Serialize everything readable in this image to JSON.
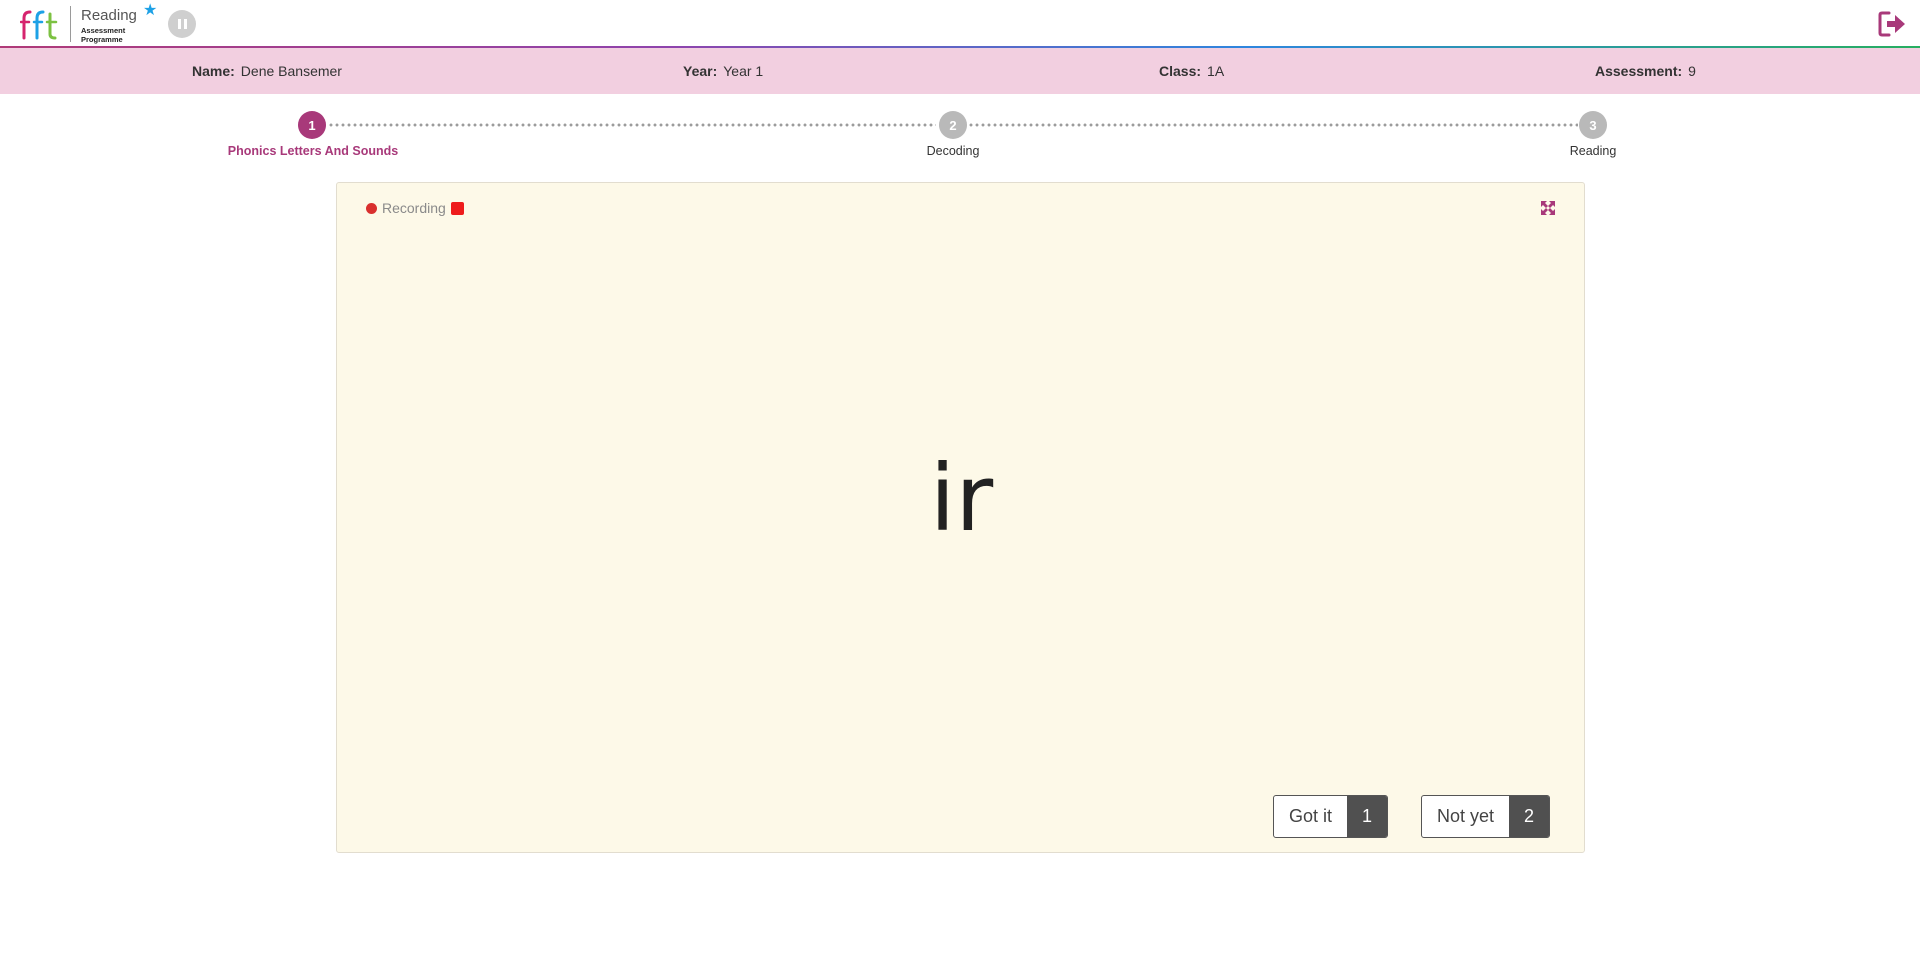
{
  "app": {
    "logo_text": "Reading",
    "logo_subtext": "Assessment Programme"
  },
  "student": {
    "name_label": "Name:",
    "name_value": "Dene Bansemer",
    "year_label": "Year:",
    "year_value": "Year 1",
    "class_label": "Class:",
    "class_value": "1A",
    "assessment_label": "Assessment:",
    "assessment_value": "9"
  },
  "steps": [
    {
      "number": "1",
      "label": "Phonics Letters And Sounds",
      "state": "active"
    },
    {
      "number": "2",
      "label": "Decoding",
      "state": "inactive"
    },
    {
      "number": "3",
      "label": "Reading",
      "state": "inactive"
    }
  ],
  "card": {
    "recording_label": "Recording",
    "grapheme": "ir"
  },
  "answers": {
    "got_it_label": "Got it",
    "got_it_key": "1",
    "not_yet_label": "Not yet",
    "not_yet_key": "2"
  },
  "colors": {
    "accent": "#a8397a",
    "info_bar": "#f2cfe0",
    "card_bg": "#fdf9e8",
    "recording_dot": "#d9302e"
  }
}
